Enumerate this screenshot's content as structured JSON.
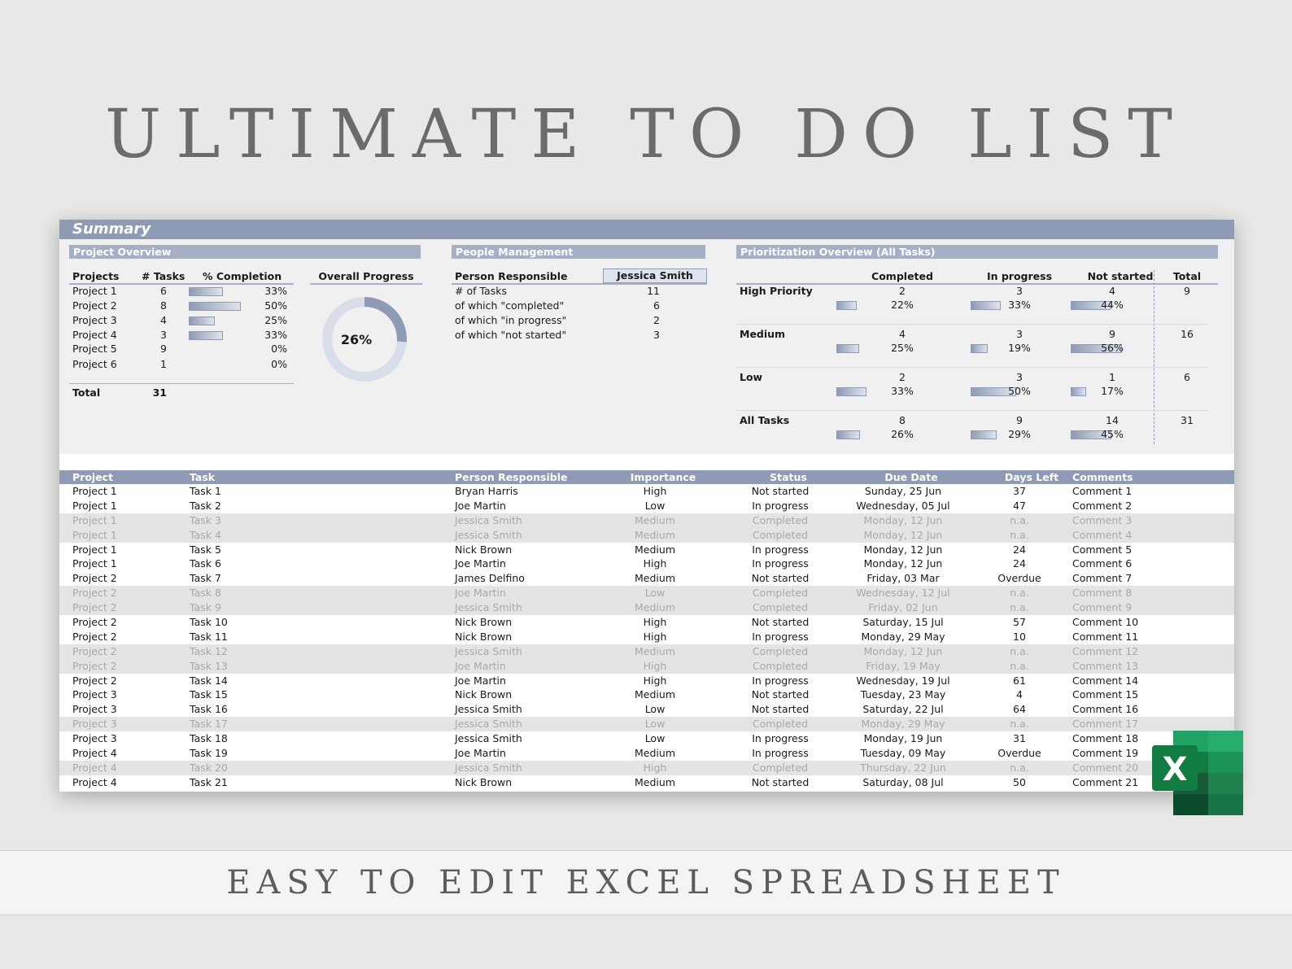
{
  "hero_title": "ULTIMATE TO DO LIST",
  "footer_text": "EASY TO EDIT EXCEL SPREADSHEET",
  "colors": {
    "accent": "#8f9bb4",
    "accent_light": "#a5b0c6",
    "excel_green": "#107c41"
  },
  "summary": {
    "title": "Summary",
    "project_overview": {
      "title": "Project Overview",
      "col_projects": "Projects",
      "col_tasks": "# Tasks",
      "col_completion": "% Completion",
      "rows": [
        {
          "name": "Project 1",
          "tasks": "6",
          "pct": "33%",
          "fill": 0.33
        },
        {
          "name": "Project 2",
          "tasks": "8",
          "pct": "50%",
          "fill": 0.5
        },
        {
          "name": "Project 3",
          "tasks": "4",
          "pct": "25%",
          "fill": 0.25
        },
        {
          "name": "Project 4",
          "tasks": "3",
          "pct": "33%",
          "fill": 0.33
        },
        {
          "name": "Project 5",
          "tasks": "9",
          "pct": "0%",
          "fill": 0
        },
        {
          "name": "Project 6",
          "tasks": "1",
          "pct": "0%",
          "fill": 0
        }
      ],
      "total_label": "Total",
      "total_value": "31"
    },
    "overall_progress": {
      "label": "Overall Progress",
      "value": "26%",
      "fill": 0.26
    },
    "people": {
      "title": "People Management",
      "label_person": "Person Responsible",
      "selected_person": "Jessica Smith",
      "rows": [
        {
          "label": "# of Tasks",
          "value": "11"
        },
        {
          "label": "of which \"completed\"",
          "value": "6"
        },
        {
          "label": "of which \"in progress\"",
          "value": "2"
        },
        {
          "label": "of which \"not started\"",
          "value": "3"
        }
      ]
    },
    "prioritization": {
      "title": "Prioritization Overview (All Tasks)",
      "col_completed": "Completed",
      "col_inprogress": "In progress",
      "col_notstarted": "Not started",
      "col_total": "Total",
      "rows": [
        {
          "label": "High Priority",
          "completed": "2",
          "completed_pct": "22%",
          "completed_fill": 0.22,
          "inprogress": "3",
          "inprogress_pct": "33%",
          "inprogress_fill": 0.33,
          "notstarted": "4",
          "notstarted_pct": "44%",
          "notstarted_fill": 0.44,
          "total": "9"
        },
        {
          "label": "Medium",
          "completed": "4",
          "completed_pct": "25%",
          "completed_fill": 0.25,
          "inprogress": "3",
          "inprogress_pct": "19%",
          "inprogress_fill": 0.19,
          "notstarted": "9",
          "notstarted_pct": "56%",
          "notstarted_fill": 0.56,
          "total": "16"
        },
        {
          "label": "Low",
          "completed": "2",
          "completed_pct": "33%",
          "completed_fill": 0.33,
          "inprogress": "3",
          "inprogress_pct": "50%",
          "inprogress_fill": 0.5,
          "notstarted": "1",
          "notstarted_pct": "17%",
          "notstarted_fill": 0.17,
          "total": "6"
        },
        {
          "label": "All Tasks",
          "completed": "8",
          "completed_pct": "26%",
          "completed_fill": 0.26,
          "inprogress": "9",
          "inprogress_pct": "29%",
          "inprogress_fill": 0.29,
          "notstarted": "14",
          "notstarted_pct": "45%",
          "notstarted_fill": 0.45,
          "total": "31"
        }
      ]
    }
  },
  "table": {
    "headers": {
      "project": "Project",
      "task": "Task",
      "person": "Person Responsible",
      "importance": "Importance",
      "status": "Status",
      "due": "Due Date",
      "days": "Days Left",
      "comments": "Comments"
    },
    "rows": [
      [
        "Project 1",
        "Task 1",
        "Bryan Harris",
        "High",
        "Not started",
        "Sunday, 25 Jun",
        "37",
        "Comment 1"
      ],
      [
        "Project 1",
        "Task 2",
        "Joe Martin",
        "Low",
        "In progress",
        "Wednesday, 05 Jul",
        "47",
        "Comment 2"
      ],
      [
        "Project 1",
        "Task 3",
        "Jessica Smith",
        "Medium",
        "Completed",
        "Monday, 12 Jun",
        "n.a.",
        "Comment 3"
      ],
      [
        "Project 1",
        "Task 4",
        "Jessica Smith",
        "Medium",
        "Completed",
        "Monday, 12 Jun",
        "n.a.",
        "Comment 4"
      ],
      [
        "Project 1",
        "Task 5",
        "Nick Brown",
        "Medium",
        "In progress",
        "Monday, 12 Jun",
        "24",
        "Comment 5"
      ],
      [
        "Project 1",
        "Task 6",
        "Joe Martin",
        "High",
        "In progress",
        "Monday, 12 Jun",
        "24",
        "Comment 6"
      ],
      [
        "Project 2",
        "Task 7",
        "James Delfino",
        "Medium",
        "Not started",
        "Friday, 03 Mar",
        "Overdue",
        "Comment 7"
      ],
      [
        "Project 2",
        "Task 8",
        "Joe Martin",
        "Low",
        "Completed",
        "Wednesday, 12 Jul",
        "n.a.",
        "Comment 8"
      ],
      [
        "Project 2",
        "Task 9",
        "Jessica Smith",
        "Medium",
        "Completed",
        "Friday, 02 Jun",
        "n.a.",
        "Comment 9"
      ],
      [
        "Project 2",
        "Task 10",
        "Nick Brown",
        "High",
        "Not started",
        "Saturday, 15 Jul",
        "57",
        "Comment 10"
      ],
      [
        "Project 2",
        "Task 11",
        "Nick Brown",
        "High",
        "In progress",
        "Monday, 29 May",
        "10",
        "Comment 11"
      ],
      [
        "Project 2",
        "Task 12",
        "Jessica Smith",
        "Medium",
        "Completed",
        "Monday, 12 Jun",
        "n.a.",
        "Comment 12"
      ],
      [
        "Project 2",
        "Task 13",
        "Joe Martin",
        "High",
        "Completed",
        "Friday, 19 May",
        "n.a.",
        "Comment 13"
      ],
      [
        "Project 2",
        "Task 14",
        "Joe Martin",
        "High",
        "In progress",
        "Wednesday, 19 Jul",
        "61",
        "Comment 14"
      ],
      [
        "Project 3",
        "Task 15",
        "Nick Brown",
        "Medium",
        "Not started",
        "Tuesday, 23 May",
        "4",
        "Comment 15"
      ],
      [
        "Project 3",
        "Task 16",
        "Jessica Smith",
        "Low",
        "Not started",
        "Saturday, 22 Jul",
        "64",
        "Comment 16"
      ],
      [
        "Project 3",
        "Task 17",
        "Jessica Smith",
        "Low",
        "Completed",
        "Monday, 29 May",
        "n.a.",
        "Comment 17"
      ],
      [
        "Project 3",
        "Task 18",
        "Jessica Smith",
        "Low",
        "In progress",
        "Monday, 19 Jun",
        "31",
        "Comment 18"
      ],
      [
        "Project 4",
        "Task 19",
        "Joe Martin",
        "Medium",
        "In progress",
        "Tuesday, 09 May",
        "Overdue",
        "Comment 19"
      ],
      [
        "Project 4",
        "Task 20",
        "Jessica Smith",
        "High",
        "Completed",
        "Thursday, 22 Jun",
        "n.a.",
        "Comment 20"
      ],
      [
        "Project 4",
        "Task 21",
        "Nick Brown",
        "Medium",
        "Not started",
        "Saturday, 08 Jul",
        "50",
        "Comment 21"
      ]
    ]
  },
  "excel_logo_letter": "X",
  "icons": {
    "logo": "excel-logo-icon"
  }
}
